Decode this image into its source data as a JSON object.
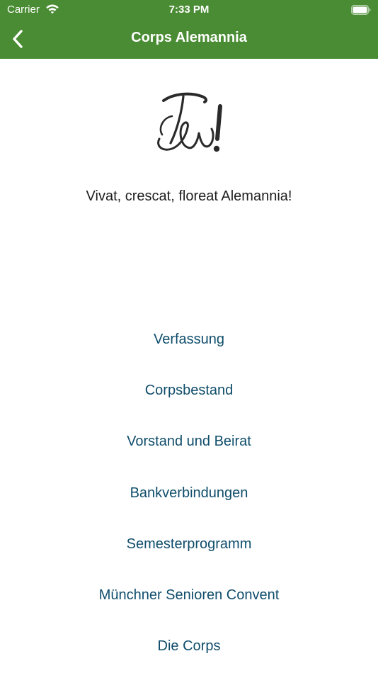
{
  "status_bar": {
    "carrier": "Carrier",
    "time": "7:33 PM",
    "wifi_icon": "wifi-icon",
    "battery_icon": "battery-icon"
  },
  "nav": {
    "title": "Corps Alemannia",
    "back_icon": "chevron-left-icon",
    "color": "#4a8c33"
  },
  "logo": {
    "description_icon": "alemannia-zirkel-logo"
  },
  "motto": "Vivat, crescat, floreat Alemannia!",
  "menu": {
    "link_color": "#0f4d6b",
    "items": [
      {
        "label": "Verfassung"
      },
      {
        "label": "Corpsbestand"
      },
      {
        "label": "Vorstand und Beirat"
      },
      {
        "label": "Bankverbindungen"
      },
      {
        "label": "Semesterprogramm"
      },
      {
        "label": "Münchner Senioren Convent"
      },
      {
        "label": "Die Corps"
      }
    ]
  }
}
